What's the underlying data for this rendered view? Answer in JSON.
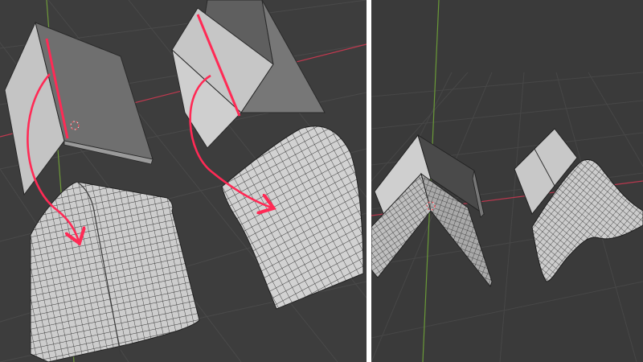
{
  "viewport_left": {
    "icons": [
      "3d-cursor-icon",
      "arrow-icon"
    ],
    "colors": {
      "background": "#3d3d3d",
      "grid": "#4a4a4a",
      "x_axis": "#c0394f",
      "y_axis": "#6f9a3a",
      "annotation": "#ff2a55",
      "mesh": "#cfcfcf"
    }
  },
  "viewport_right": {
    "icons": [
      "3d-cursor-icon"
    ],
    "colors": {
      "background": "#3a3a3a",
      "grid": "#484848",
      "x_axis": "#b8384e",
      "y_axis": "#6a9a38",
      "mesh": "#c9c9c9"
    }
  }
}
